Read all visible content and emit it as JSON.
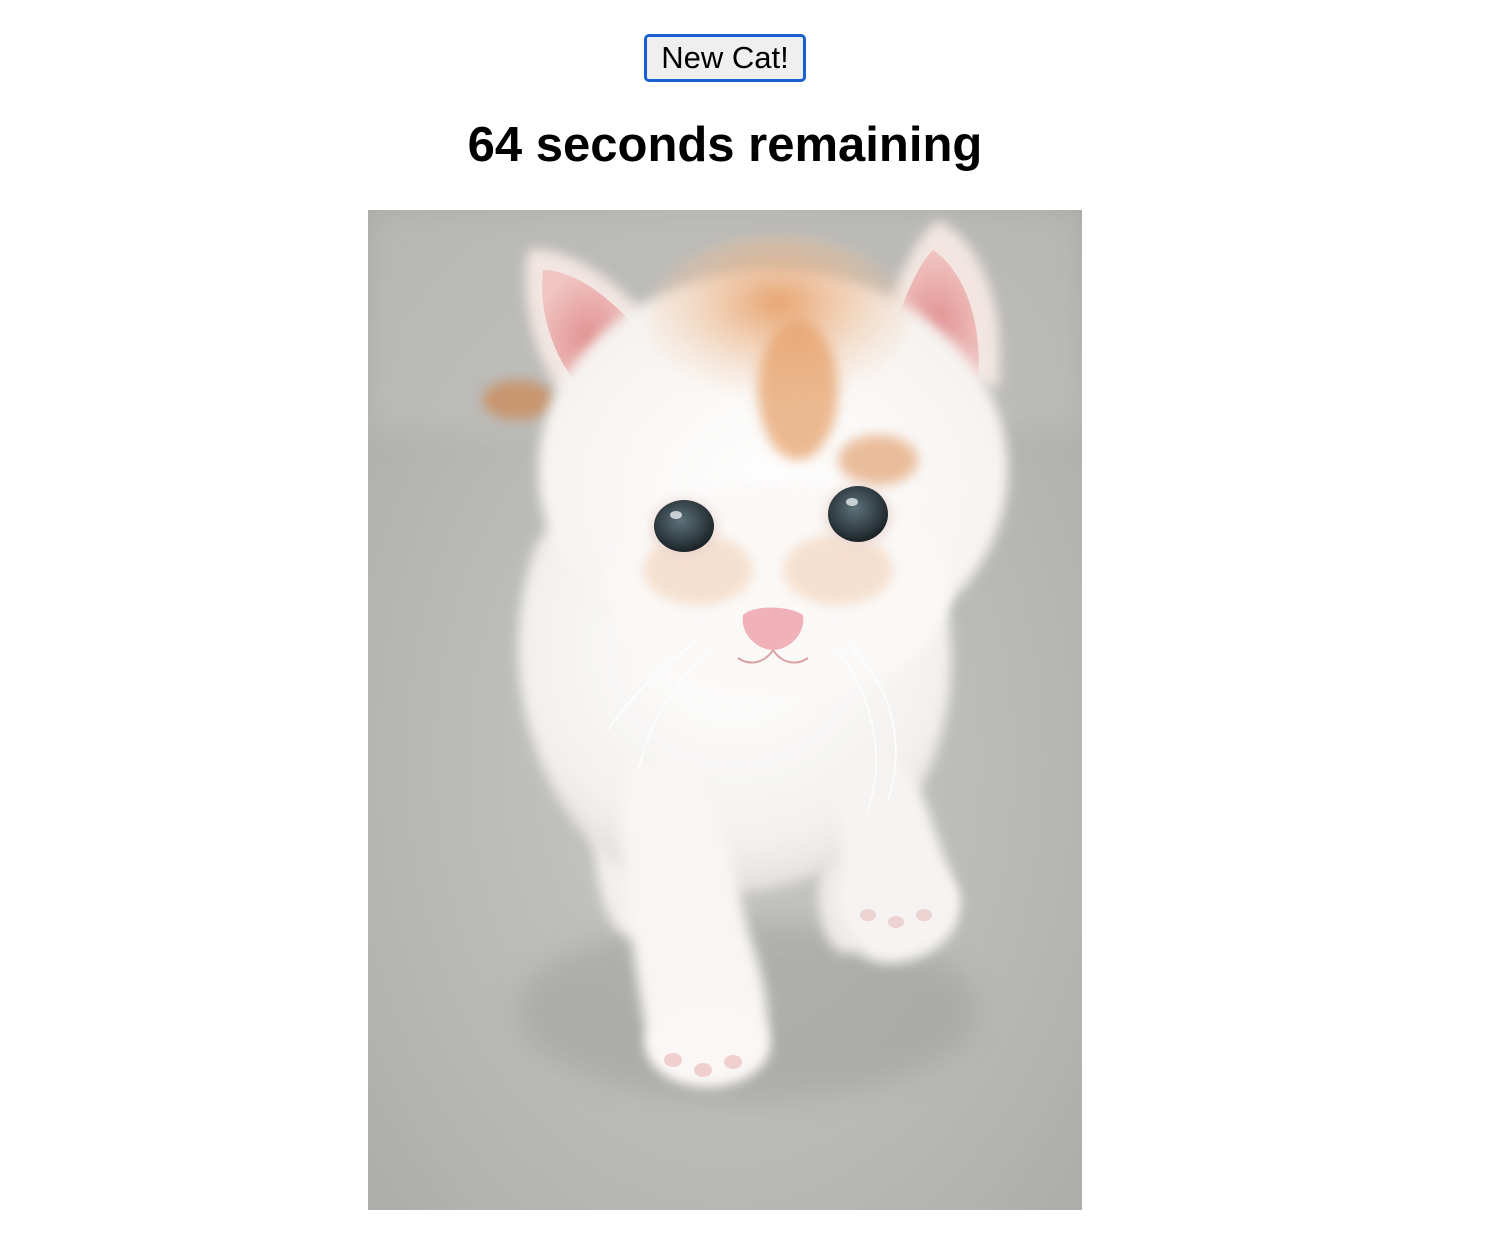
{
  "controls": {
    "new_cat_label": "New Cat!"
  },
  "timer": {
    "text": "64 seconds remaining"
  },
  "photo": {
    "subject": "kitten-photo",
    "colors": {
      "floor": "#b9b9b7",
      "fur_white": "#f6f3f1",
      "fur_orange": "#e3a878",
      "ear_pink": "#e8a3a3",
      "eye": "#3b4a52",
      "nose": "#f2b3b8"
    }
  }
}
